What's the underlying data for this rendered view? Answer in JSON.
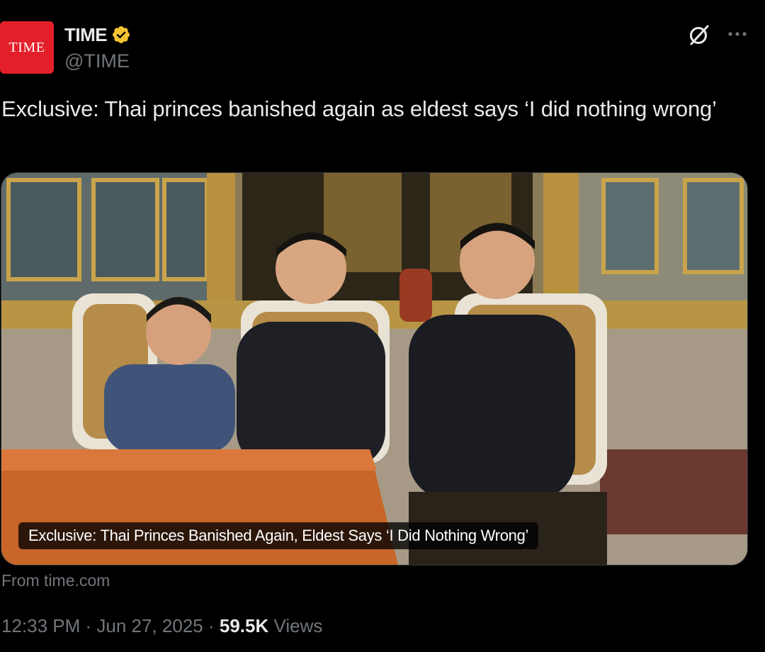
{
  "author": {
    "avatar_text": "TIME",
    "display_name": "TIME",
    "handle": "@TIME",
    "verified": true,
    "verified_color": "#f4c430",
    "avatar_color": "#e3202a"
  },
  "actions": {
    "grok_icon": "slashed-circle-icon",
    "more_icon": "ellipsis-icon"
  },
  "tweet": {
    "text": "Exclusive: Thai princes banished again as eldest says ‘I did nothing wrong’"
  },
  "card": {
    "caption": "Exclusive: Thai Princes Banished Again, Eldest Says ‘I Did Nothing Wrong’",
    "source": "From time.com",
    "image_subject": "photo-three-boys-seated-palace"
  },
  "meta": {
    "time": "12:33 PM",
    "separator": " · ",
    "date": "Jun 27, 2025",
    "views_count": "59.5K",
    "views_label": "Views"
  }
}
